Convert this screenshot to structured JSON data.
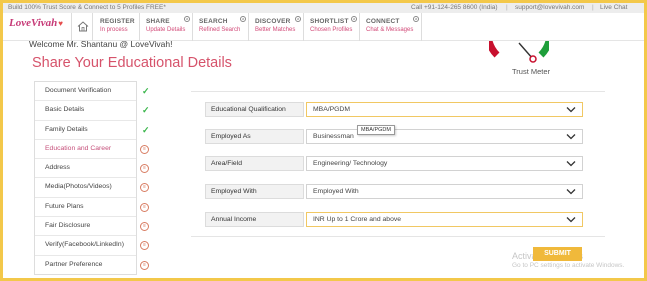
{
  "topbar": {
    "promo": "Build 100% Trust Score & Connect to 5 Profiles FREE*",
    "call": "Call +91-124-265 8600 (India)",
    "email": "support@lovevivah.com",
    "live_chat": "Live Chat",
    "separator": "|"
  },
  "logo": {
    "text": "LoveVivah"
  },
  "nav": [
    {
      "title": "REGISTER",
      "sub": "In process",
      "locked": false
    },
    {
      "title": "SHARE",
      "sub": "Update Details",
      "locked": true
    },
    {
      "title": "SEARCH",
      "sub": "Refined Search",
      "locked": true
    },
    {
      "title": "DISCOVER",
      "sub": "Better Matches",
      "locked": true
    },
    {
      "title": "SHORTLIST",
      "sub": "Chosen Profiles",
      "locked": true
    },
    {
      "title": "CONNECT",
      "sub": "Chat & Messages",
      "locked": true
    }
  ],
  "welcome": "Welcome Mr. Shantanu @ LoveVivah!",
  "heading": "Share Your Educational Details",
  "trust_meter": {
    "label": "Trust Meter"
  },
  "steps": [
    {
      "label": "Document Verification",
      "status": "done"
    },
    {
      "label": "Basic Details",
      "status": "done"
    },
    {
      "label": "Family Details",
      "status": "done"
    },
    {
      "label": "Education and Career",
      "status": "pending",
      "active": true
    },
    {
      "label": "Address",
      "status": "pending"
    },
    {
      "label": "Media(Photos/Videos)",
      "status": "pending"
    },
    {
      "label": "Future Plans",
      "status": "pending"
    },
    {
      "label": "Fair Disclosure",
      "status": "pending"
    },
    {
      "label": "Verify(Facebook/LinkedIn)",
      "status": "pending"
    },
    {
      "label": "Partner Preference",
      "status": "pending"
    }
  ],
  "form": {
    "fields": [
      {
        "label": "Educational Qualification",
        "value": "MBA/PGDM",
        "highlight": true
      },
      {
        "label": "Employed As",
        "value": "Businessman",
        "highlight": false
      },
      {
        "label": "Area/Field",
        "value": "Engineering/ Technology",
        "highlight": false
      },
      {
        "label": "Employed With",
        "value": "Employed With",
        "highlight": false
      },
      {
        "label": "Annual Income",
        "value": "INR Up to 1 Crore and above",
        "highlight": true
      }
    ],
    "tooltip": "MBA/PGDM",
    "submit": "SUBMIT"
  },
  "watermark": {
    "line1": "Activate Windows",
    "line2": "Go to PC settings to activate Windows."
  },
  "colors": {
    "accent": "#d6536b",
    "brand_pink": "#c63a77",
    "button": "#f0b93b",
    "check": "#39b54a",
    "frame": "#f3c84a"
  }
}
